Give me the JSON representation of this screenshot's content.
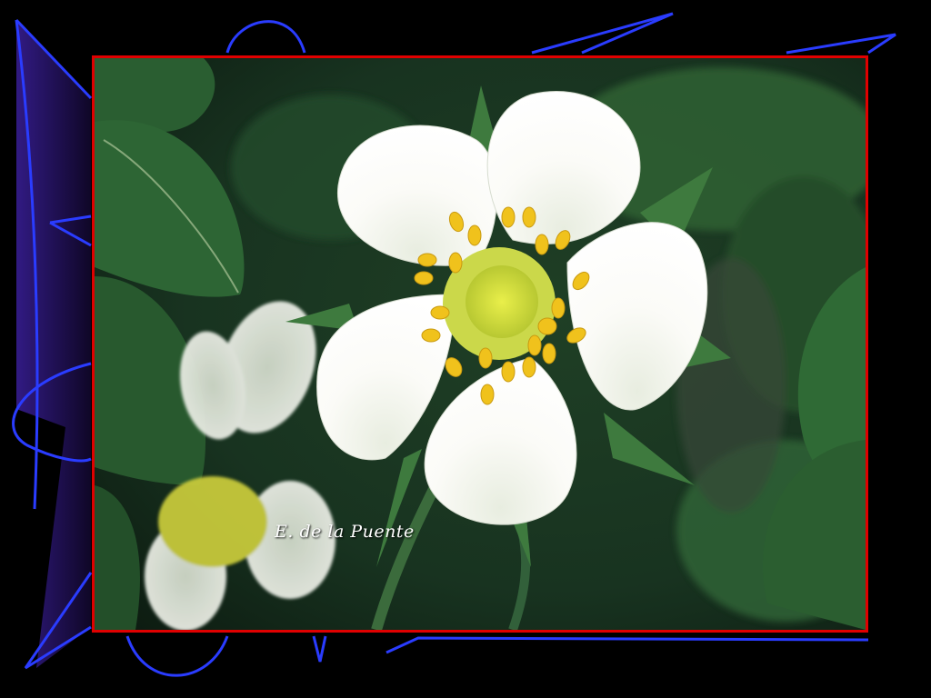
{
  "slide": {
    "credit": "E. de la Puente",
    "frame_border_color": "#e00000",
    "decoration_color": "#2a3cff",
    "background_color": "#000000"
  },
  "photo": {
    "subject": "white-five-petal-flower",
    "center_color": "#e8e000",
    "petal_color": "#ffffff",
    "foliage_color": "#2f6a35"
  }
}
